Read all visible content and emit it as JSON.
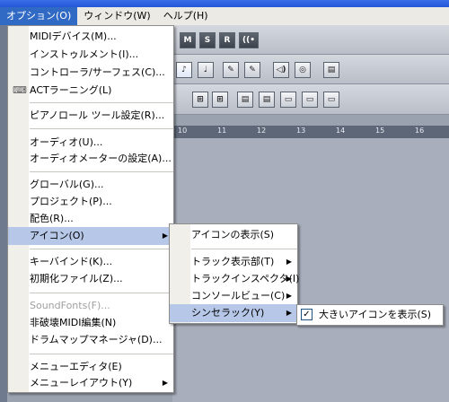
{
  "menubar": {
    "items": [
      "オプション(O)",
      "ウィンドウ(W)",
      "ヘルプ(H)"
    ],
    "active_index": 0
  },
  "toolbar": {
    "row1_buttons": [
      "M",
      "S",
      "R",
      "((•"
    ],
    "row2_buttons": [
      "♪",
      "♩",
      "✎",
      "✎",
      "◁)",
      "◎",
      "▤"
    ],
    "row3_buttons": [
      "⊞",
      "⊞",
      "▤",
      "▤",
      "▭",
      "▭",
      "▭"
    ]
  },
  "ruler": {
    "ticks": [
      "10",
      "11",
      "12",
      "13",
      "14",
      "15",
      "16"
    ]
  },
  "options_menu": {
    "items": [
      {
        "label": "MIDIデバイス(M)..."
      },
      {
        "label": "インストゥルメント(I)..."
      },
      {
        "label": "コントローラ/サーフェス(C)..."
      },
      {
        "label": "ACTラーニング(L)",
        "icon": "act-learning-icon"
      },
      {
        "label": "ピアノロール ツール設定(R)..."
      },
      {
        "label": "オーディオ(U)..."
      },
      {
        "label": "オーディオメーターの設定(A)..."
      },
      {
        "label": "グローバル(G)..."
      },
      {
        "label": "プロジェクト(P)..."
      },
      {
        "label": "配色(R)..."
      },
      {
        "label": "アイコン(O)",
        "submenu": true,
        "selected": true
      },
      {
        "label": "キーバインド(K)..."
      },
      {
        "label": "初期化ファイル(Z)..."
      },
      {
        "label": "SoundFonts(F)...",
        "disabled": true
      },
      {
        "label": "非破壊MIDI編集(N)"
      },
      {
        "label": "ドラムマップマネージャ(D)..."
      },
      {
        "label": "メニューエディタ(E)"
      },
      {
        "label": "メニューレイアウト(Y)",
        "submenu": true
      }
    ]
  },
  "icons_submenu": {
    "items": [
      {
        "label": "アイコンの表示(S)"
      },
      {
        "label": "トラック表示部(T)",
        "submenu": true
      },
      {
        "label": "トラックインスペクタ(I)",
        "submenu": true
      },
      {
        "label": "コンソールビュー(C)",
        "submenu": true
      },
      {
        "label": "シンセラック(Y)",
        "submenu": true,
        "selected": true
      }
    ]
  },
  "synthrack_submenu": {
    "items": [
      {
        "label": "大きいアイコンを表示(S)",
        "checked": true
      }
    ]
  },
  "colors": {
    "menu_highlight": "#b6c7e8",
    "menubar_active": "#316ac5"
  }
}
